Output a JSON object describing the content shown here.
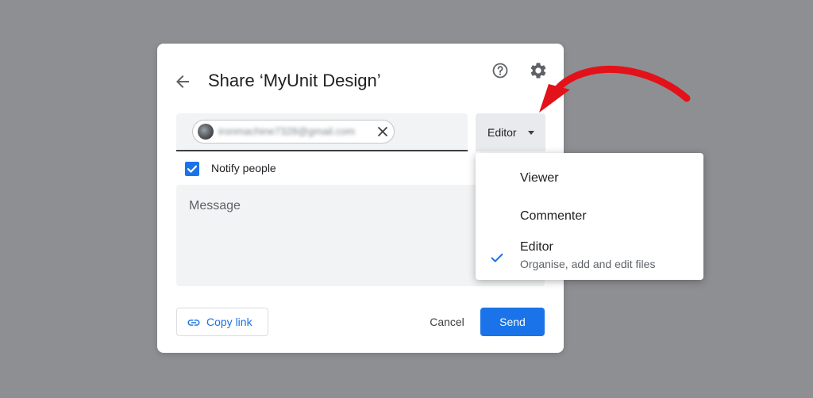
{
  "dialog": {
    "title": "Share ‘MyUnit Design’",
    "back_icon": "arrow-back-icon",
    "help_icon": "help-icon",
    "settings_icon": "gear-icon"
  },
  "recipient": {
    "email": "ironmachine7328@gmail.com",
    "remove_icon": "close-icon"
  },
  "role_button": {
    "label": "Editor",
    "icon": "caret-down-icon"
  },
  "notify": {
    "label": "Notify people",
    "checked": true
  },
  "message": {
    "placeholder": "Message"
  },
  "footer": {
    "copy_link_label": "Copy link",
    "copy_link_icon": "link-icon",
    "cancel_label": "Cancel",
    "send_label": "Send"
  },
  "role_menu": {
    "items": [
      {
        "label": "Viewer",
        "selected": false
      },
      {
        "label": "Commenter",
        "selected": false
      },
      {
        "label": "Editor",
        "description": "Organise, add and edit files",
        "selected": true
      }
    ],
    "check_icon": "checkmark-icon"
  },
  "colors": {
    "accent": "#1a73e8",
    "backdrop": "#8e8f93",
    "annotation_arrow": "#e3121a"
  }
}
